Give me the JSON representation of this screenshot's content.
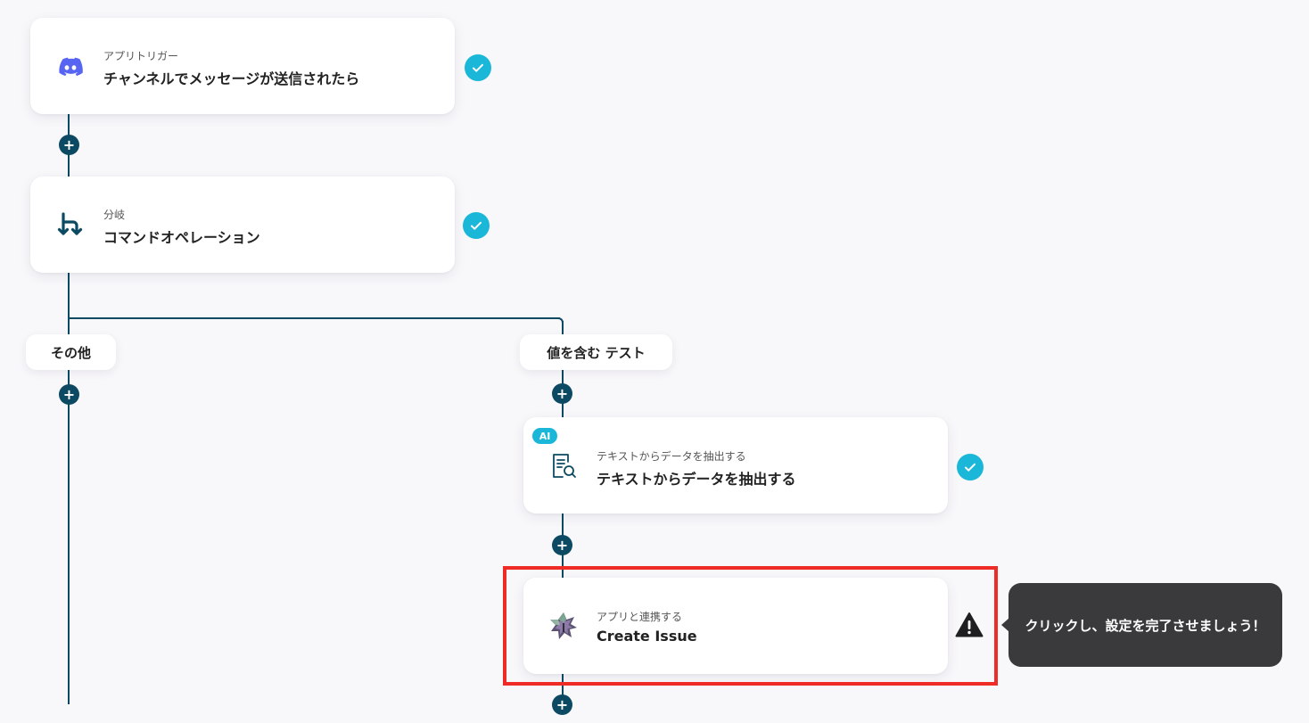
{
  "steps": [
    {
      "subtitle": "アプリトリガー",
      "title": "チャンネルでメッセージが送信されたら",
      "icon": "discord-icon",
      "status": "complete"
    },
    {
      "subtitle": "分岐",
      "title": "コマンドオペレーション",
      "icon": "branch-icon",
      "status": "complete"
    },
    {
      "subtitle": "テキストからデータを抽出する",
      "title": "テキストからデータを抽出する",
      "icon": "document-search-icon",
      "badge": "AI",
      "status": "complete"
    },
    {
      "subtitle": "アプリと連携する",
      "title": "Create Issue",
      "icon": "app-star-icon",
      "status": "warning"
    }
  ],
  "branches": [
    {
      "label": "その他"
    },
    {
      "label": "値を含む テスト"
    }
  ],
  "add_symbol": "+",
  "tooltip": {
    "text": "クリックし、設定を完了させましょう！"
  },
  "colors": {
    "line": "#0c4a63",
    "check": "#1bb7d9",
    "highlight": "#ee2b24",
    "tooltip_bg": "#3a3a3d",
    "discord": "#5865f2"
  }
}
